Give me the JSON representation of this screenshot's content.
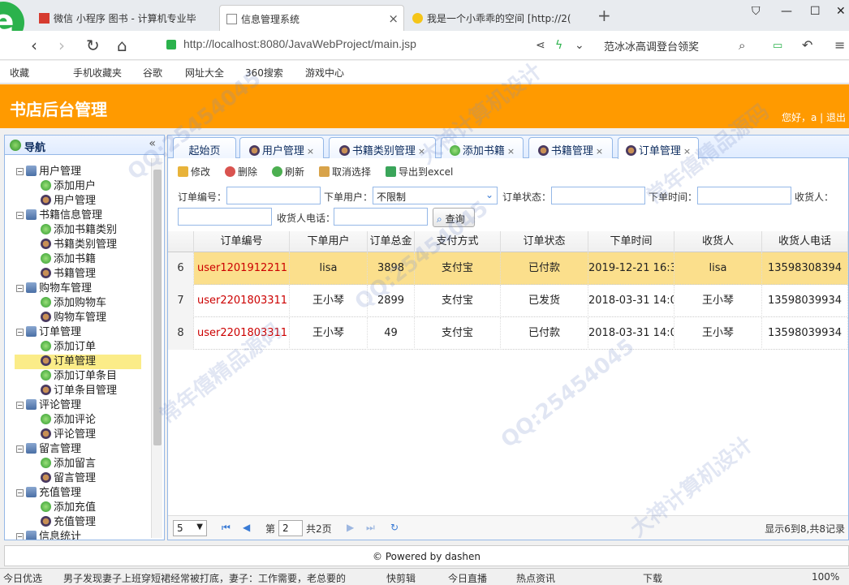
{
  "browser": {
    "tabs": [
      {
        "title": "微信 小程序 图书 - 计算机专业毕"
      },
      {
        "title": "信息管理系统"
      },
      {
        "title": "我是一个小乖乖的空间 [http://2("
      }
    ],
    "url": "http://localhost:8080/JavaWebProject/main.jsp",
    "search_hint": "范冰冰高调登台领奖",
    "bookmarks": [
      "收藏",
      "手机收藏夹",
      "谷歌",
      "网址大全",
      "360搜索",
      "游戏中心"
    ]
  },
  "header": {
    "title": "书店后台管理",
    "welcome": "您好，a | 退出"
  },
  "sidebar": {
    "title": "导航",
    "collapse_glyph": "«",
    "groups": [
      {
        "label": "用户管理",
        "items": [
          "添加用户",
          "用户管理"
        ]
      },
      {
        "label": "书籍信息管理",
        "items": [
          "添加书籍类别",
          "书籍类别管理",
          "添加书籍",
          "书籍管理"
        ]
      },
      {
        "label": "购物车管理",
        "items": [
          "添加购物车",
          "购物车管理"
        ]
      },
      {
        "label": "订单管理",
        "items": [
          "添加订单",
          "订单管理",
          "添加订单条目",
          "订单条目管理"
        ]
      },
      {
        "label": "评论管理",
        "items": [
          "添加评论",
          "评论管理"
        ]
      },
      {
        "label": "留言管理",
        "items": [
          "添加留言",
          "留言管理"
        ]
      },
      {
        "label": "充值管理",
        "items": [
          "添加充值",
          "充值管理"
        ]
      },
      {
        "label": "信息统计",
        "items": []
      }
    ]
  },
  "tabs": [
    "起始页",
    "用户管理",
    "书籍类别管理",
    "添加书籍",
    "书籍管理",
    "订单管理"
  ],
  "toolbar": {
    "edit": "修改",
    "delete": "删除",
    "refresh": "刷新",
    "cancel_select": "取消选择",
    "export": "导出到excel"
  },
  "filters": {
    "order_no": "订单编号：",
    "order_user": "下单用户：",
    "order_user_value": "不限制",
    "order_state": "订单状态：",
    "order_time": "下单时间：",
    "receiver": "收货人：",
    "receiver_phone": "收货人电话：",
    "query": "查询"
  },
  "table": {
    "headers": [
      "订单编号",
      "下单用户",
      "订单总金",
      "支付方式",
      "订单状态",
      "下单时间",
      "收货人",
      "收货人电话"
    ],
    "rows": [
      {
        "rn": "6",
        "cells": [
          "user1201912211",
          "lisa",
          "3898",
          "支付宝",
          "已付款",
          "2019-12-21 16:3",
          "lisa",
          "13598308394"
        ]
      },
      {
        "rn": "7",
        "cells": [
          "user2201803311",
          "王小琴",
          "2899",
          "支付宝",
          "已发货",
          "2018-03-31 14:0",
          "王小琴",
          "13598039934"
        ]
      },
      {
        "rn": "8",
        "cells": [
          "user2201803311",
          "王小琴",
          "49",
          "支付宝",
          "已付款",
          "2018-03-31 14:0",
          "王小琴",
          "13598039934"
        ]
      }
    ]
  },
  "pager": {
    "page_size": "5",
    "page_prefix": "第",
    "page_value": "2",
    "total_pages": "共2页",
    "summary": "显示6到8,共8记录"
  },
  "footer": "© Powered by dashen",
  "statusbar": [
    "今日优选",
    "男子发现妻子上班穿短裙经常被打底，妻子：工作需要，老总要的",
    "快剪辑",
    "今日直播",
    "热点资讯",
    "下载",
    "100%"
  ],
  "watermarks": [
    "QQ:25454045",
    "常年僖精品源码",
    "大神计算机设计"
  ]
}
